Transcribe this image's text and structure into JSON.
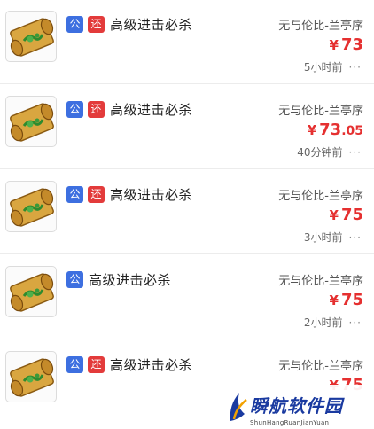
{
  "colors": {
    "accent_red": "#e53030",
    "tag_blue": "#3d6fe0",
    "tag_red": "#e33b3b"
  },
  "listings": [
    {
      "tags": [
        "公",
        "还"
      ],
      "name": "高级进击必杀",
      "server": "无与伦比-兰亭序",
      "yen": "¥",
      "price": "73",
      "cents": "",
      "time": "5小时前",
      "more": "···"
    },
    {
      "tags": [
        "公",
        "还"
      ],
      "name": "高级进击必杀",
      "server": "无与伦比-兰亭序",
      "yen": "¥",
      "price": "73",
      "cents": ".05",
      "time": "40分钟前",
      "more": "···"
    },
    {
      "tags": [
        "公",
        "还"
      ],
      "name": "高级进击必杀",
      "server": "无与伦比-兰亭序",
      "yen": "¥",
      "price": "75",
      "cents": "",
      "time": "3小时前",
      "more": "···"
    },
    {
      "tags": [
        "公"
      ],
      "name": "高级进击必杀",
      "server": "无与伦比-兰亭序",
      "yen": "¥",
      "price": "75",
      "cents": "",
      "time": "2小时前",
      "more": "···"
    },
    {
      "tags": [
        "公",
        "还"
      ],
      "name": "高级进击必杀",
      "server": "无与伦比-兰亭序",
      "yen": "¥",
      "price": "75",
      "cents": "",
      "time": "",
      "more": ""
    }
  ],
  "watermark": {
    "title": "瞬航软件园",
    "subtitle": "ShunHangRuanJianYuan"
  }
}
